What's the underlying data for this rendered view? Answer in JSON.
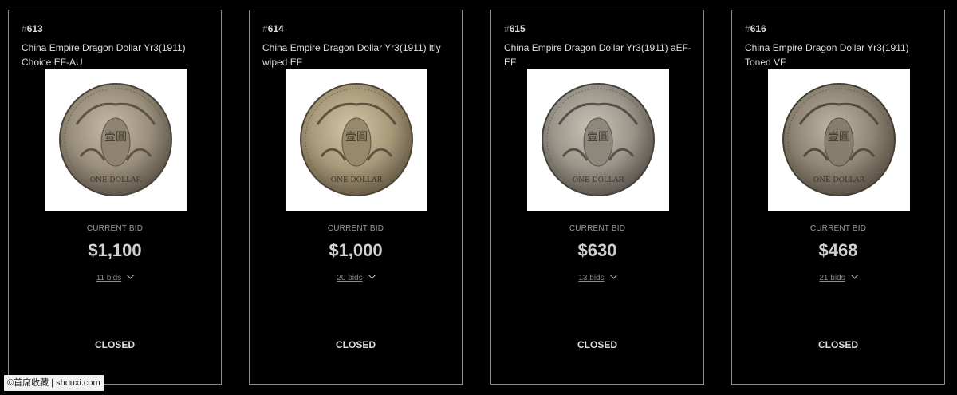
{
  "lots": [
    {
      "hash": "#",
      "number": "613",
      "title": "China Empire Dragon Dollar Yr3(1911) Choice EF-AU",
      "image_icon": "coin-image",
      "bid_label": "CURRENT BID",
      "bid_amount": "$1,100",
      "bids_text": "11 bids",
      "status": "CLOSED"
    },
    {
      "hash": "#",
      "number": "614",
      "title": "China Empire Dragon Dollar Yr3(1911) ltly wiped EF",
      "image_icon": "coin-image",
      "bid_label": "CURRENT BID",
      "bid_amount": "$1,000",
      "bids_text": "20 bids",
      "status": "CLOSED"
    },
    {
      "hash": "#",
      "number": "615",
      "title": "China Empire Dragon Dollar Yr3(1911) aEF-EF",
      "image_icon": "coin-image",
      "bid_label": "CURRENT BID",
      "bid_amount": "$630",
      "bids_text": "13 bids",
      "status": "CLOSED"
    },
    {
      "hash": "#",
      "number": "616",
      "title": "China Empire Dragon Dollar Yr3(1911) Toned VF",
      "image_icon": "coin-image",
      "bid_label": "CURRENT BID",
      "bid_amount": "$468",
      "bids_text": "21 bids",
      "status": "CLOSED"
    }
  ],
  "coin_text": {
    "center": "壹圓",
    "bottom": "ONE DOLLAR"
  },
  "watermark": "©首席收藏 | shouxi.com",
  "colors": {
    "background": "#000000",
    "card_border": "#8a8a8a",
    "text": "#dddddd",
    "muted": "#9a9a9a"
  }
}
